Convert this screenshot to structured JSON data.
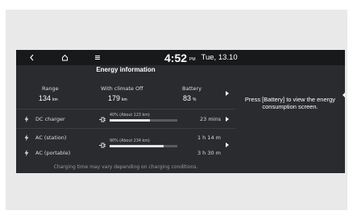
{
  "status_bar": {
    "time": "4:52",
    "ampm": "PM",
    "date": "Tue, 13.10"
  },
  "nav_icons": [
    "back-icon",
    "home-icon",
    "menu-icon"
  ],
  "title": "Energy information",
  "summary": {
    "range": {
      "label": "Range",
      "value": "134",
      "unit": "km"
    },
    "climate": {
      "label": "With climate Off",
      "value": "179",
      "unit": "km"
    },
    "battery": {
      "label": "Battery",
      "value": "83",
      "unit": "%"
    }
  },
  "chargers": [
    {
      "label": "DC charger",
      "target": "40% (About 123 km)",
      "level": 0.6,
      "time": "23 mins"
    },
    {
      "label": "AC (station)",
      "target": "90% (About 234 km)",
      "level": 0.8,
      "time": "1 h 14 m"
    },
    {
      "label": "AC (portable)",
      "time": "3 h 30 m"
    }
  ],
  "footnote": "Charging time may vary depending on charging conditions.",
  "side_message": "Press [Battery] to view the energy consumption screen.",
  "colors": {
    "screen_bg": "#2a2b2e",
    "topbar_bg": "#18191b",
    "text": "#e8e8e8"
  }
}
